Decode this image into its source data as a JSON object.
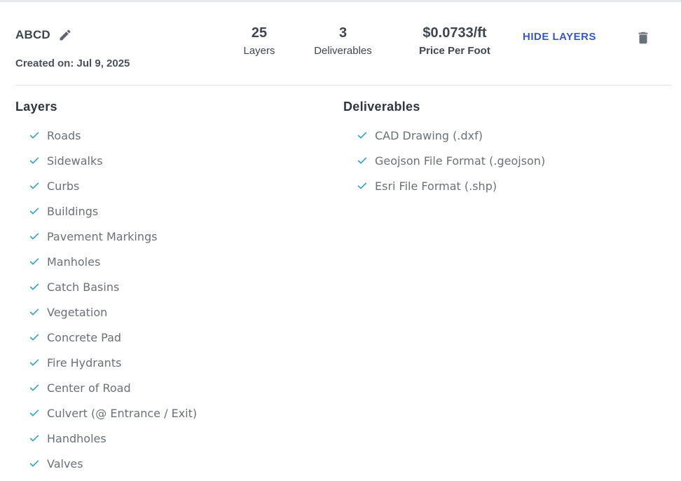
{
  "project": {
    "name": "ABCD",
    "created": "Created on: Jul 9, 2025"
  },
  "stats": {
    "layers": {
      "value": "25",
      "label": "Layers"
    },
    "deliverables": {
      "value": "3",
      "label": "Deliverables"
    },
    "price": {
      "value": "$0.0733/ft",
      "label": "Price Per Foot"
    }
  },
  "actions": {
    "hide_layers": "HIDE LAYERS"
  },
  "icons": {
    "edit": "pencil-icon",
    "delete": "trash-icon",
    "check": "checkmark-icon"
  },
  "colors": {
    "accent_link": "#3a55c9",
    "check": "#2a9fd6",
    "icon_gray": "#5f6670"
  },
  "sections": {
    "layers_title": "Layers",
    "deliverables_title": "Deliverables"
  },
  "layers": [
    "Roads",
    "Sidewalks",
    "Curbs",
    "Buildings",
    "Pavement Markings",
    "Manholes",
    "Catch Basins",
    "Vegetation",
    "Concrete Pad",
    "Fire Hydrants",
    "Center of Road",
    "Culvert (@ Entrance / Exit)",
    "Handholes",
    "Valves"
  ],
  "deliverables": [
    "CAD Drawing (.dxf)",
    "Geojson File Format (.geojson)",
    "Esri File Format (.shp)"
  ]
}
